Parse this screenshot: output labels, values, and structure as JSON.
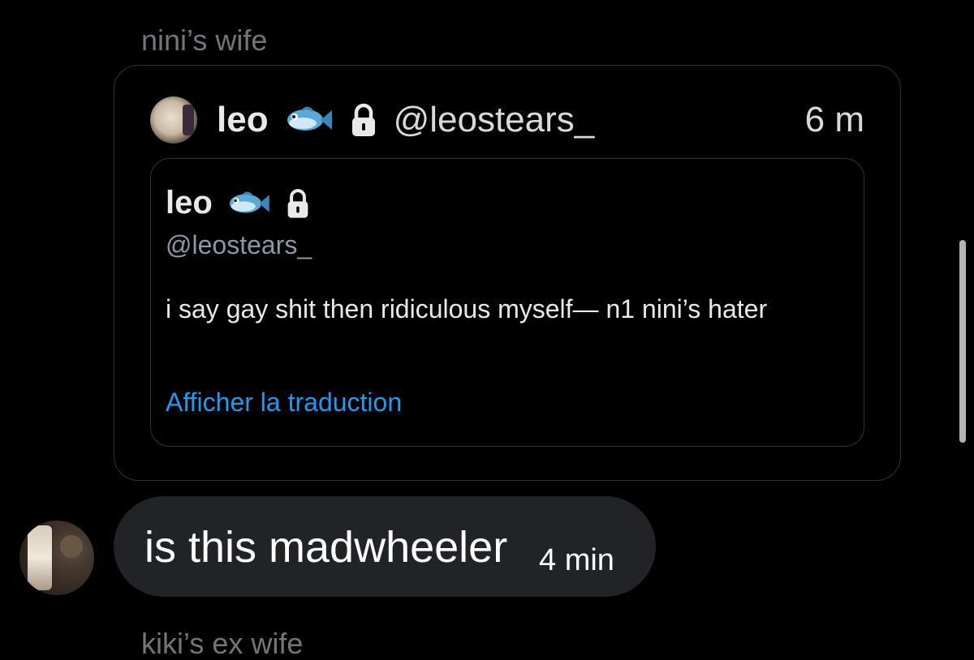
{
  "conversation": {
    "top_sender": "nini’s wife",
    "bottom_sender": "kiki’s ex wife"
  },
  "quoted_post": {
    "display_name": "leo",
    "badge_icon": "fish-icon",
    "protected_icon": "lock-icon",
    "handle": "@leostears_",
    "timestamp": "6 m",
    "inner_post": {
      "display_name": "leo",
      "handle": "@leostears_",
      "body": "i say gay shit then ridiculous myself— n1 nini’s hater",
      "translate_label": "Afficher la traduction"
    }
  },
  "message": {
    "text": "is this madwheeler",
    "time": "4 min"
  },
  "colors": {
    "background": "#000000",
    "bubble": "#212327",
    "border": "#2f3336",
    "link": "#1d9bf0",
    "muted": "#71767b"
  }
}
